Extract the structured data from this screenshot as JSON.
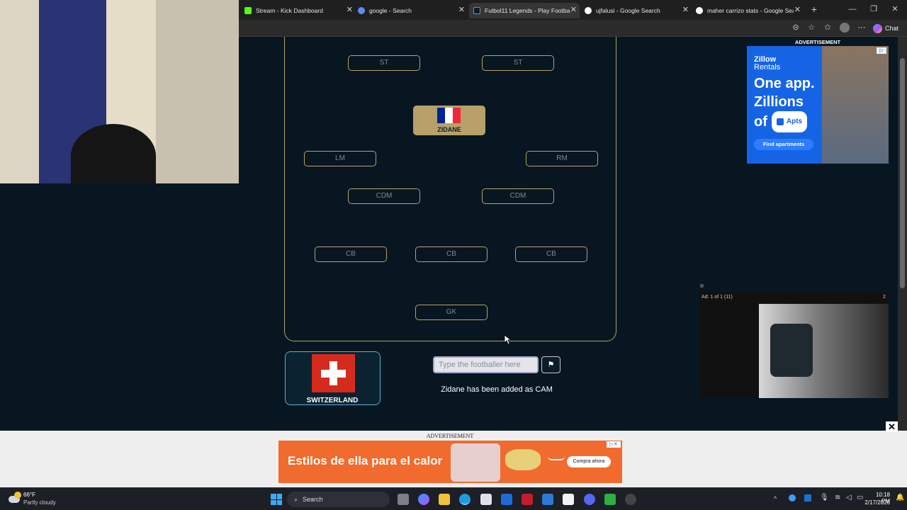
{
  "browser": {
    "tabs": [
      {
        "label": "Stream - Kick Dashboard",
        "active": false
      },
      {
        "label": "google - Search",
        "active": false
      },
      {
        "label": "Futbol11 Legends - Play Football",
        "active": true
      },
      {
        "label": "ujfalusi - Google Search",
        "active": false
      },
      {
        "label": "maher carrizo stats - Google Search",
        "active": false
      }
    ],
    "chat_label": "Chat"
  },
  "field": {
    "slots": {
      "st_left": "ST",
      "st_right": "ST",
      "lm": "LM",
      "rm": "RM",
      "cdm_left": "CDM",
      "cdm_right": "CDM",
      "cb_left": "CB",
      "cb_center": "CB",
      "cb_right": "CB",
      "gk": "GK"
    },
    "placed_player": {
      "name": "ZIDANE",
      "flag_colors": [
        "#002395",
        "#ffffff",
        "#ed2939"
      ]
    }
  },
  "country_card": {
    "name": "SWITZERLAND"
  },
  "input": {
    "placeholder": "Type the footballer here"
  },
  "status_message": "Zidane has been added as CAM",
  "ads": {
    "top_label": "ADVERTISEMENT",
    "zillow": {
      "brand_line1": "Zillow",
      "brand_line2": "Rentals",
      "headline1": "One app.",
      "headline2": "Zillions",
      "headline3": "of",
      "chip": "Apts",
      "cta": "Find apartments"
    },
    "video": {
      "counter": "Ad: 1 of 1 (11)",
      "countdown": "2"
    },
    "bottom_label": "ADVERTISEMENT",
    "bottom": {
      "headline": "Estilos de ella para el calor",
      "cta": "Compra ahora"
    }
  },
  "taskbar": {
    "weather_temp": "66°F",
    "weather_desc": "Partly cloudy",
    "search_label": "Search",
    "time": "10:18 PM",
    "date": "2/17/2026"
  }
}
